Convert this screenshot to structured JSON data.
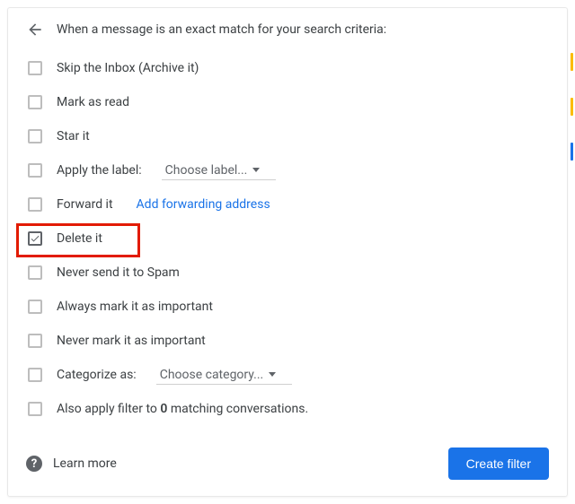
{
  "header": "When a message is an exact match for your search criteria:",
  "options": {
    "skip_inbox": "Skip the Inbox (Archive it)",
    "mark_read": "Mark as read",
    "star_it": "Star it",
    "apply_label": "Apply the label:",
    "choose_label": "Choose label...",
    "forward_it": "Forward it",
    "add_forwarding": "Add forwarding address",
    "delete_it": "Delete it",
    "never_spam": "Never send it to Spam",
    "always_important": "Always mark it as important",
    "never_important": "Never mark it as important",
    "categorize_as": "Categorize as:",
    "choose_category": "Choose category...",
    "also_apply_prefix": "Also apply filter to ",
    "also_apply_count": "0",
    "also_apply_suffix": " matching conversations."
  },
  "footer": {
    "learn_more": "Learn more",
    "create_filter": "Create filter"
  },
  "colors": {
    "stripe1": "#fbbc04",
    "stripe2": "#fbbc04",
    "stripe3": "#1a73e8"
  }
}
